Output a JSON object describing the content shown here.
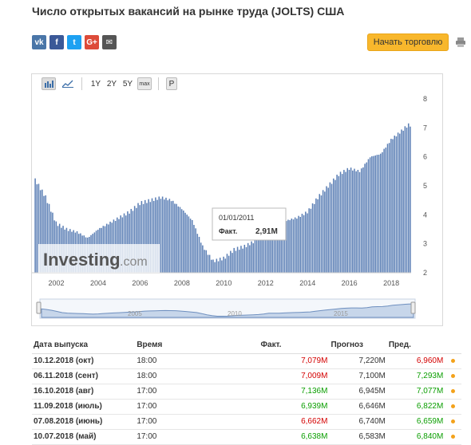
{
  "title": "Число открытых вакансий на рынке труда (JOLTS) США",
  "share_icons": [
    {
      "name": "vk-icon",
      "glyph": "vk",
      "color": "#4a76a8"
    },
    {
      "name": "facebook-icon",
      "glyph": "f",
      "color": "#3b5998"
    },
    {
      "name": "twitter-icon",
      "glyph": "t",
      "color": "#1da1f2"
    },
    {
      "name": "google-plus-icon",
      "glyph": "G+",
      "color": "#dd4b39"
    },
    {
      "name": "mail-icon",
      "glyph": "✉",
      "color": "#555555"
    }
  ],
  "trade_button": "Начать торговлю",
  "toolbar": {
    "ranges": [
      "1Y",
      "2Y",
      "5Y",
      "max"
    ],
    "p_label": "P"
  },
  "watermark": {
    "brand": "Investing",
    "suffix": ".com"
  },
  "tooltip": {
    "date": "01/01/2011",
    "label": "Факт.",
    "value": "2,91M"
  },
  "navigator_labels": [
    "2005",
    "2010",
    "2015"
  ],
  "colors": {
    "bar": "#5b7fb5",
    "accent_button": "#f8b72c",
    "red": "#d40000",
    "green": "#0a9e00"
  },
  "chart_data": {
    "type": "bar",
    "x_tick_labels": [
      "2002",
      "2004",
      "2006",
      "2008",
      "2010",
      "2012",
      "2014",
      "2016",
      "2018"
    ],
    "y_tick_labels": [
      "2",
      "3",
      "4",
      "5",
      "6",
      "7",
      "8"
    ],
    "ylim": [
      2,
      8
    ],
    "xlim": [
      2000.95,
      2018.95
    ],
    "grid": false,
    "series": [
      {
        "x": [
          2001.0,
          2001.5,
          2002.0,
          2002.5,
          2003.0,
          2003.5,
          2004.0,
          2004.5,
          2005.0,
          2005.5,
          2006.0,
          2006.5,
          2007.0,
          2007.5,
          2008.0,
          2008.5,
          2009.0,
          2009.5,
          2010.0,
          2010.5,
          2011.0,
          2011.5,
          2012.0,
          2012.5,
          2013.0,
          2013.5,
          2014.0,
          2014.5,
          2015.0,
          2015.5,
          2016.0,
          2016.5,
          2017.0,
          2017.5,
          2018.0,
          2018.5,
          2018.8
        ],
        "values": [
          5.2,
          4.6,
          3.7,
          3.5,
          3.4,
          3.2,
          3.5,
          3.7,
          3.9,
          4.1,
          4.4,
          4.5,
          4.6,
          4.5,
          4.2,
          3.8,
          2.9,
          2.4,
          2.5,
          2.8,
          2.91,
          3.1,
          3.6,
          3.6,
          3.8,
          3.9,
          4.1,
          4.6,
          5.0,
          5.4,
          5.6,
          5.5,
          6.0,
          6.1,
          6.6,
          6.9,
          7.1
        ]
      }
    ]
  },
  "table": {
    "headers": [
      "Дата выпуска",
      "Время",
      "Факт.",
      "Прогноз",
      "Пред."
    ],
    "rows": [
      {
        "date": "10.12.2018 (окт)",
        "time": "18:00",
        "actual": "7,079M",
        "actual_color": "red",
        "forecast": "7,220M",
        "prev": "6,960M",
        "prev_color": "red"
      },
      {
        "date": "06.11.2018 (сент)",
        "time": "18:00",
        "actual": "7,009M",
        "actual_color": "red",
        "forecast": "7,100M",
        "prev": "7,293M",
        "prev_color": "green"
      },
      {
        "date": "16.10.2018 (авг)",
        "time": "17:00",
        "actual": "7,136M",
        "actual_color": "green",
        "forecast": "6,945M",
        "prev": "7,077M",
        "prev_color": "green"
      },
      {
        "date": "11.09.2018 (июль)",
        "time": "17:00",
        "actual": "6,939M",
        "actual_color": "green",
        "forecast": "6,646M",
        "prev": "6,822M",
        "prev_color": "green"
      },
      {
        "date": "07.08.2018 (июнь)",
        "time": "17:00",
        "actual": "6,662M",
        "actual_color": "red",
        "forecast": "6,740M",
        "prev": "6,659M",
        "prev_color": "green"
      },
      {
        "date": "10.07.2018 (май)",
        "time": "17:00",
        "actual": "6,638M",
        "actual_color": "green",
        "forecast": "6,583M",
        "prev": "6,840M",
        "prev_color": "green"
      }
    ]
  }
}
